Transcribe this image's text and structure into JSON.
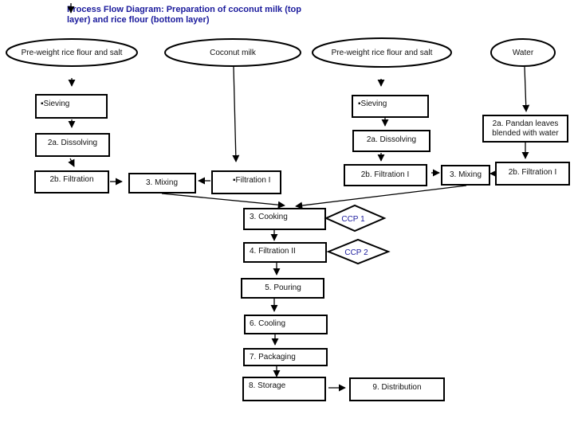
{
  "title": "Process Flow Diagram: Preparation of coconut milk (top layer) and rice flour (bottom layer)",
  "inputs": {
    "rice_flour_left": "Pre-weight rice flour and salt",
    "coconut_milk": "Coconut milk",
    "rice_flour_right": "Pre-weight rice flour and salt",
    "water": "Water"
  },
  "left_branch": {
    "sieving": "Sieving",
    "dissolving": "2a. Dissolving",
    "filtration": "2b. Filtration",
    "mixing": "3. Mixing"
  },
  "coconut_branch": {
    "filtration": "Filtration I"
  },
  "right_branch": {
    "sieving": "Sieving",
    "dissolving": "2a. Dissolving",
    "filtration": "2b. Filtration I",
    "mixing": "3. Mixing"
  },
  "water_branch": {
    "pandan_line1": "2a. Pandan leaves",
    "pandan_line2": "blended with water",
    "filtration": "2b. Filtration I"
  },
  "main_steps": {
    "cooking": "3. Cooking",
    "filtration2": "4. Filtration II",
    "pouring": "5. Pouring",
    "cooling": "6. Cooling",
    "packaging": "7. Packaging",
    "storage": "8. Storage",
    "distribution": "9. Distribution"
  },
  "control_points": {
    "ccp1": "CCP 1",
    "ccp2": "CCP 2"
  },
  "bullet": "▪"
}
